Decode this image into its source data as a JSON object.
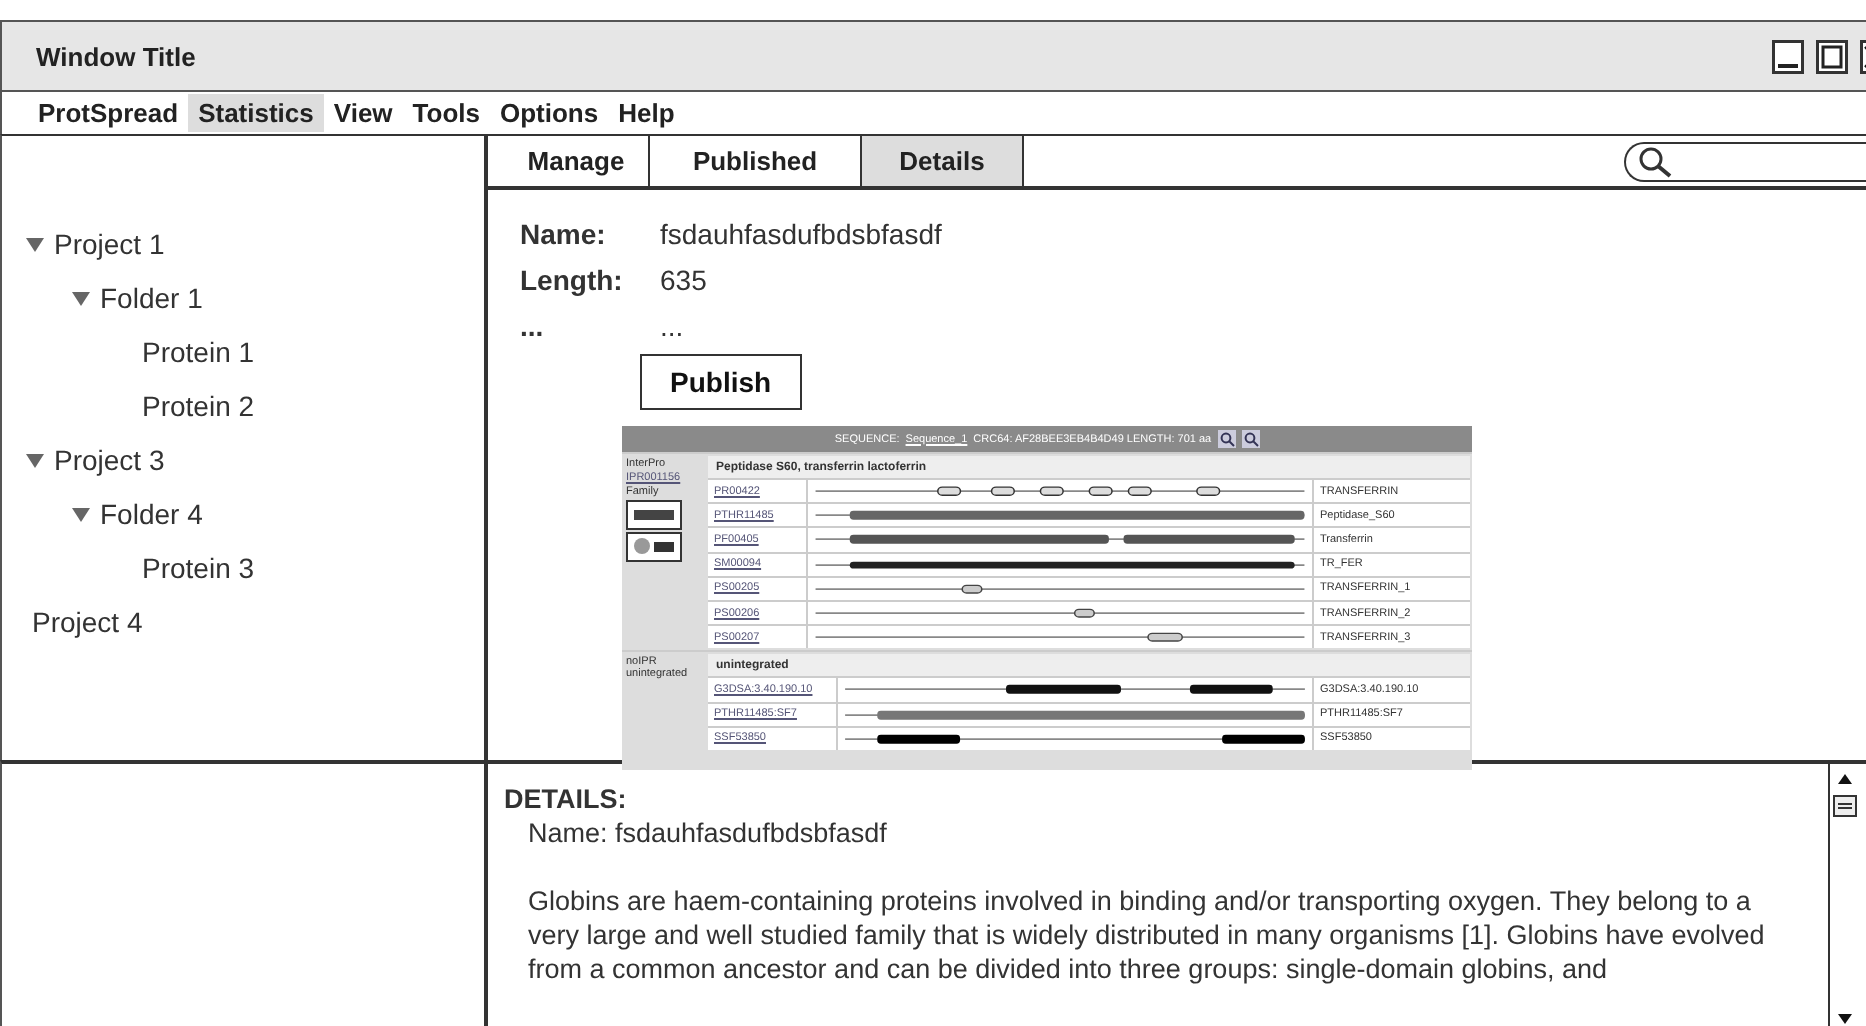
{
  "window": {
    "title": "Window Title"
  },
  "menu": [
    {
      "label": "ProtSpread",
      "selected": false
    },
    {
      "label": "Statistics",
      "selected": true
    },
    {
      "label": "View",
      "selected": false
    },
    {
      "label": "Tools",
      "selected": false
    },
    {
      "label": "Options",
      "selected": false
    },
    {
      "label": "Help",
      "selected": false
    }
  ],
  "tree": [
    {
      "label": "Project 1",
      "expanded": true,
      "children": [
        {
          "label": "Folder 1",
          "expanded": true,
          "children": [
            {
              "label": "Protein 1"
            },
            {
              "label": "Protein 2"
            }
          ]
        }
      ]
    },
    {
      "label": "Project 3",
      "expanded": true,
      "children": [
        {
          "label": "Folder 4",
          "expanded": true,
          "children": [
            {
              "label": "Protein 3"
            }
          ]
        }
      ]
    },
    {
      "label": "Project 4"
    }
  ],
  "tabs": [
    {
      "label": "Manage",
      "selected": false
    },
    {
      "label": "Published",
      "selected": false
    },
    {
      "label": "Details",
      "selected": true
    }
  ],
  "fields": [
    {
      "label": "Name:",
      "value": "fsdauhfasdufbdsbfasdf"
    },
    {
      "label": "Length:",
      "value": "635"
    },
    {
      "label": "...",
      "value": "..."
    }
  ],
  "publish_button": "Publish",
  "interpro": {
    "header_prefix": "SEQUENCE:",
    "sequence_link": "Sequence_1",
    "header_rest": "CRC64: AF28BEE3EB4B4D49 LENGTH: 701 aa",
    "sections": [
      {
        "label": "InterPro",
        "accession": "IPR001156",
        "type": "Family",
        "title": "Peptidase S60, transferrin lactoferrin",
        "rows": [
          {
            "id": "PR00422",
            "name": "TRANSFERRIN"
          },
          {
            "id": "PTHR11485",
            "name": "Peptidase_S60"
          },
          {
            "id": "PF00405",
            "name": "Transferrin"
          },
          {
            "id": "SM00094",
            "name": "TR_FER"
          },
          {
            "id": "PS00205",
            "name": "TRANSFERRIN_1"
          },
          {
            "id": "PS00206",
            "name": "TRANSFERRIN_2"
          },
          {
            "id": "PS00207",
            "name": "TRANSFERRIN_3"
          }
        ]
      },
      {
        "label": "noIPR unintegrated",
        "title": "unintegrated",
        "rows": [
          {
            "id": "G3DSA:3.40.190.10",
            "name": "G3DSA:3.40.190.10"
          },
          {
            "id": "PTHR11485:SF7",
            "name": "PTHR11485:SF7"
          },
          {
            "id": "SSF53850",
            "name": "SSF53850"
          }
        ]
      }
    ]
  },
  "details": {
    "heading": "DETAILS:",
    "name_line": "Name: fsdauhfasdufbdsbfasdf",
    "paragraph": "Globins are haem-containing proteins involved in binding and/or transporting oxygen. They belong to a very large and well studied family that is widely distributed in many organisms [1]. Globins have evolved from a common ancestor and can be divided into three groups: single-domain globins, and"
  }
}
